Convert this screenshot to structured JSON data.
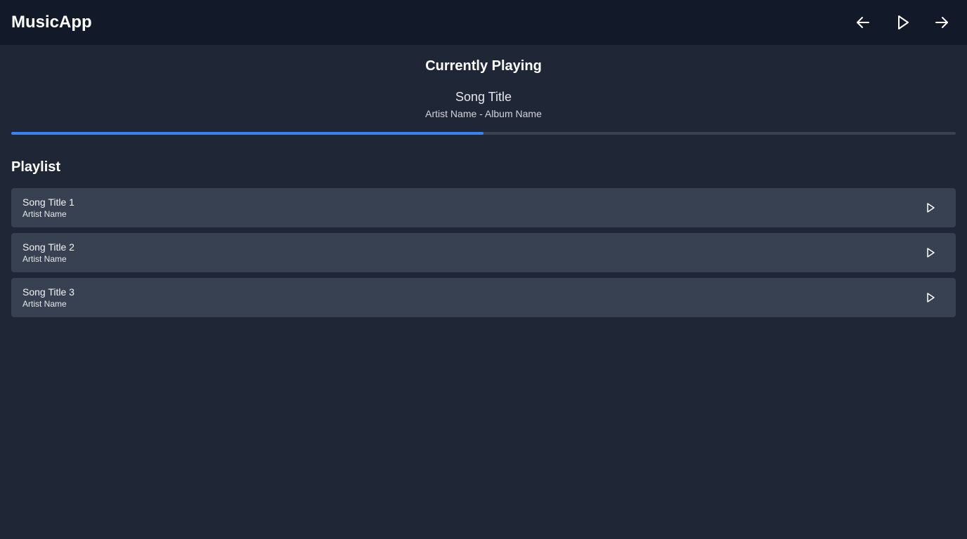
{
  "header": {
    "app_title": "MusicApp",
    "controls": {
      "previous_icon": "arrow-left-icon",
      "play_icon": "play-icon",
      "next_icon": "arrow-right-icon"
    }
  },
  "now_playing": {
    "heading": "Currently Playing",
    "song_title": "Song Title",
    "artist_album": "Artist Name - Album Name",
    "progress": 0.5
  },
  "playlist": {
    "heading": "Playlist",
    "tracks": [
      {
        "title": "Song Title 1",
        "artist": "Artist Name",
        "icon": "play-icon"
      },
      {
        "title": "Song Title 2",
        "artist": "Artist Name",
        "icon": "play-icon"
      },
      {
        "title": "Song Title 3",
        "artist": "Artist Name",
        "icon": "play-icon"
      }
    ]
  },
  "colors": {
    "background": "#1f2737",
    "header_background": "#121a2a",
    "card_background": "#374151",
    "progress_track": "#3a4252",
    "accent": "#3b82f6"
  }
}
